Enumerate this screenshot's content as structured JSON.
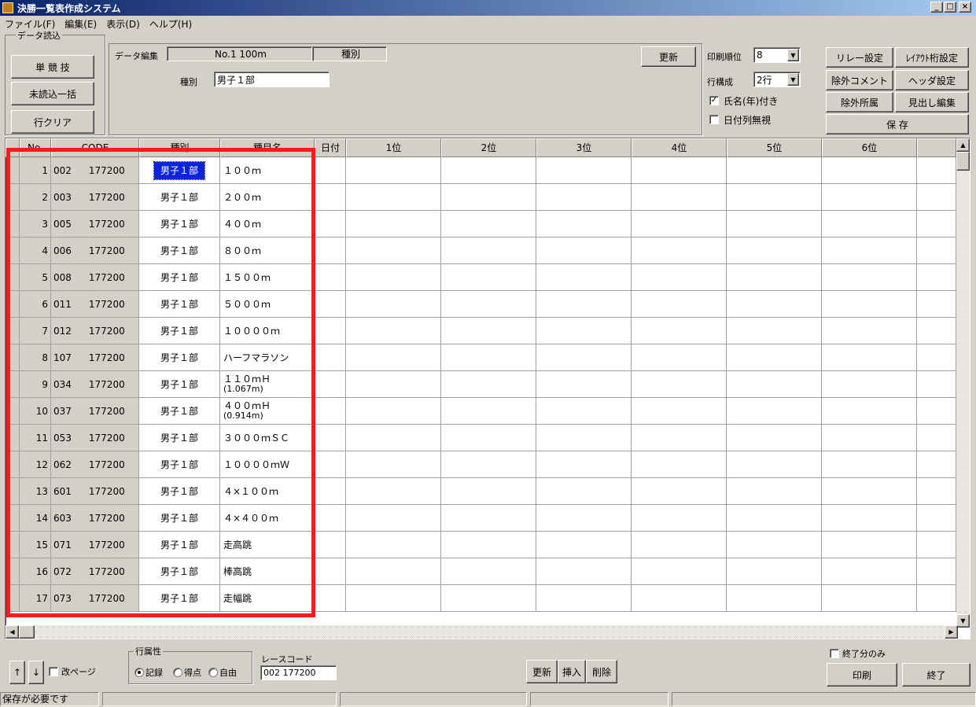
{
  "window": {
    "title": "決勝一覧表作成システム",
    "min": "_",
    "max": "□",
    "close": "×"
  },
  "menu": [
    "ファイル(F)",
    "編集(E)",
    "表示(D)",
    "ヘルプ(H)"
  ],
  "data_load": {
    "group": "データ読込",
    "single": "単 競 技",
    "unread_all": "未読込一括",
    "row_clear": "行クリア"
  },
  "data_edit": {
    "group": "データ編集",
    "event_value": "No.1 100m",
    "category_label": "種別",
    "category_input_label": "種別",
    "category_input_value": "男子１部",
    "update": "更新"
  },
  "print_options": {
    "print_rank_label": "印刷順位",
    "print_rank_value": "8",
    "row_layout_label": "行構成",
    "row_layout_value": "2行",
    "name_year_label": "氏名(年)付き",
    "name_year_checked": true,
    "ignore_date_label": "日付列無視",
    "ignore_date_checked": false
  },
  "right_buttons": {
    "relay": "リレー設定",
    "layout_digits": "ﾚｲｱｳﾄ桁設定",
    "exclude_comment": "除外コメント",
    "header": "ヘッダ設定",
    "exclude_affil": "除外所属",
    "heading_edit": "見出し編集",
    "save": "保 存"
  },
  "grid": {
    "columns": [
      "No.",
      "CODE",
      "種別",
      "種目名",
      "日付",
      "1位",
      "2位",
      "3位",
      "4位",
      "5位",
      "6位"
    ],
    "rows": [
      {
        "no": "1",
        "code1": "002",
        "code2": "177200",
        "cat": "男子１部",
        "event": "１００ｍ",
        "event2": ""
      },
      {
        "no": "2",
        "code1": "003",
        "code2": "177200",
        "cat": "男子１部",
        "event": "２００ｍ",
        "event2": ""
      },
      {
        "no": "3",
        "code1": "005",
        "code2": "177200",
        "cat": "男子１部",
        "event": "４００ｍ",
        "event2": ""
      },
      {
        "no": "4",
        "code1": "006",
        "code2": "177200",
        "cat": "男子１部",
        "event": "８００ｍ",
        "event2": ""
      },
      {
        "no": "5",
        "code1": "008",
        "code2": "177200",
        "cat": "男子１部",
        "event": "１５００ｍ",
        "event2": ""
      },
      {
        "no": "6",
        "code1": "011",
        "code2": "177200",
        "cat": "男子１部",
        "event": "５０００ｍ",
        "event2": ""
      },
      {
        "no": "7",
        "code1": "012",
        "code2": "177200",
        "cat": "男子１部",
        "event": "１００００ｍ",
        "event2": ""
      },
      {
        "no": "8",
        "code1": "107",
        "code2": "177200",
        "cat": "男子１部",
        "event": "ハーフマラソン",
        "event2": ""
      },
      {
        "no": "9",
        "code1": "034",
        "code2": "177200",
        "cat": "男子１部",
        "event": "１１０ｍＨ",
        "event2": "(1.067m)"
      },
      {
        "no": "10",
        "code1": "037",
        "code2": "177200",
        "cat": "男子１部",
        "event": "４００ｍＨ",
        "event2": "(0.914m)"
      },
      {
        "no": "11",
        "code1": "053",
        "code2": "177200",
        "cat": "男子１部",
        "event": "３０００ｍＳＣ",
        "event2": ""
      },
      {
        "no": "12",
        "code1": "062",
        "code2": "177200",
        "cat": "男子１部",
        "event": "１００００ｍＷ",
        "event2": ""
      },
      {
        "no": "13",
        "code1": "601",
        "code2": "177200",
        "cat": "男子１部",
        "event": "４×１００ｍ",
        "event2": ""
      },
      {
        "no": "14",
        "code1": "603",
        "code2": "177200",
        "cat": "男子１部",
        "event": "４×４００ｍ",
        "event2": ""
      },
      {
        "no": "15",
        "code1": "071",
        "code2": "177200",
        "cat": "男子１部",
        "event": "走高跳",
        "event2": ""
      },
      {
        "no": "16",
        "code1": "072",
        "code2": "177200",
        "cat": "男子１部",
        "event": "棒高跳",
        "event2": ""
      },
      {
        "no": "17",
        "code1": "073",
        "code2": "177200",
        "cat": "男子１部",
        "event": "走幅跳",
        "event2": ""
      }
    ]
  },
  "bottom": {
    "up": "↑",
    "down": "↓",
    "page_break": "改ページ",
    "row_attr_group": "行属性",
    "radio_record": "記録",
    "radio_score": "得点",
    "radio_free": "自由",
    "race_code_label": "レースコード",
    "race_code_value": "002 177200",
    "update": "更新",
    "insert": "挿入",
    "delete": "削除",
    "finished_only": "終了分のみ",
    "print": "印刷",
    "exit": "終了"
  },
  "status": {
    "message": "保存が必要です"
  },
  "highlight_color": "#ff1a1a"
}
